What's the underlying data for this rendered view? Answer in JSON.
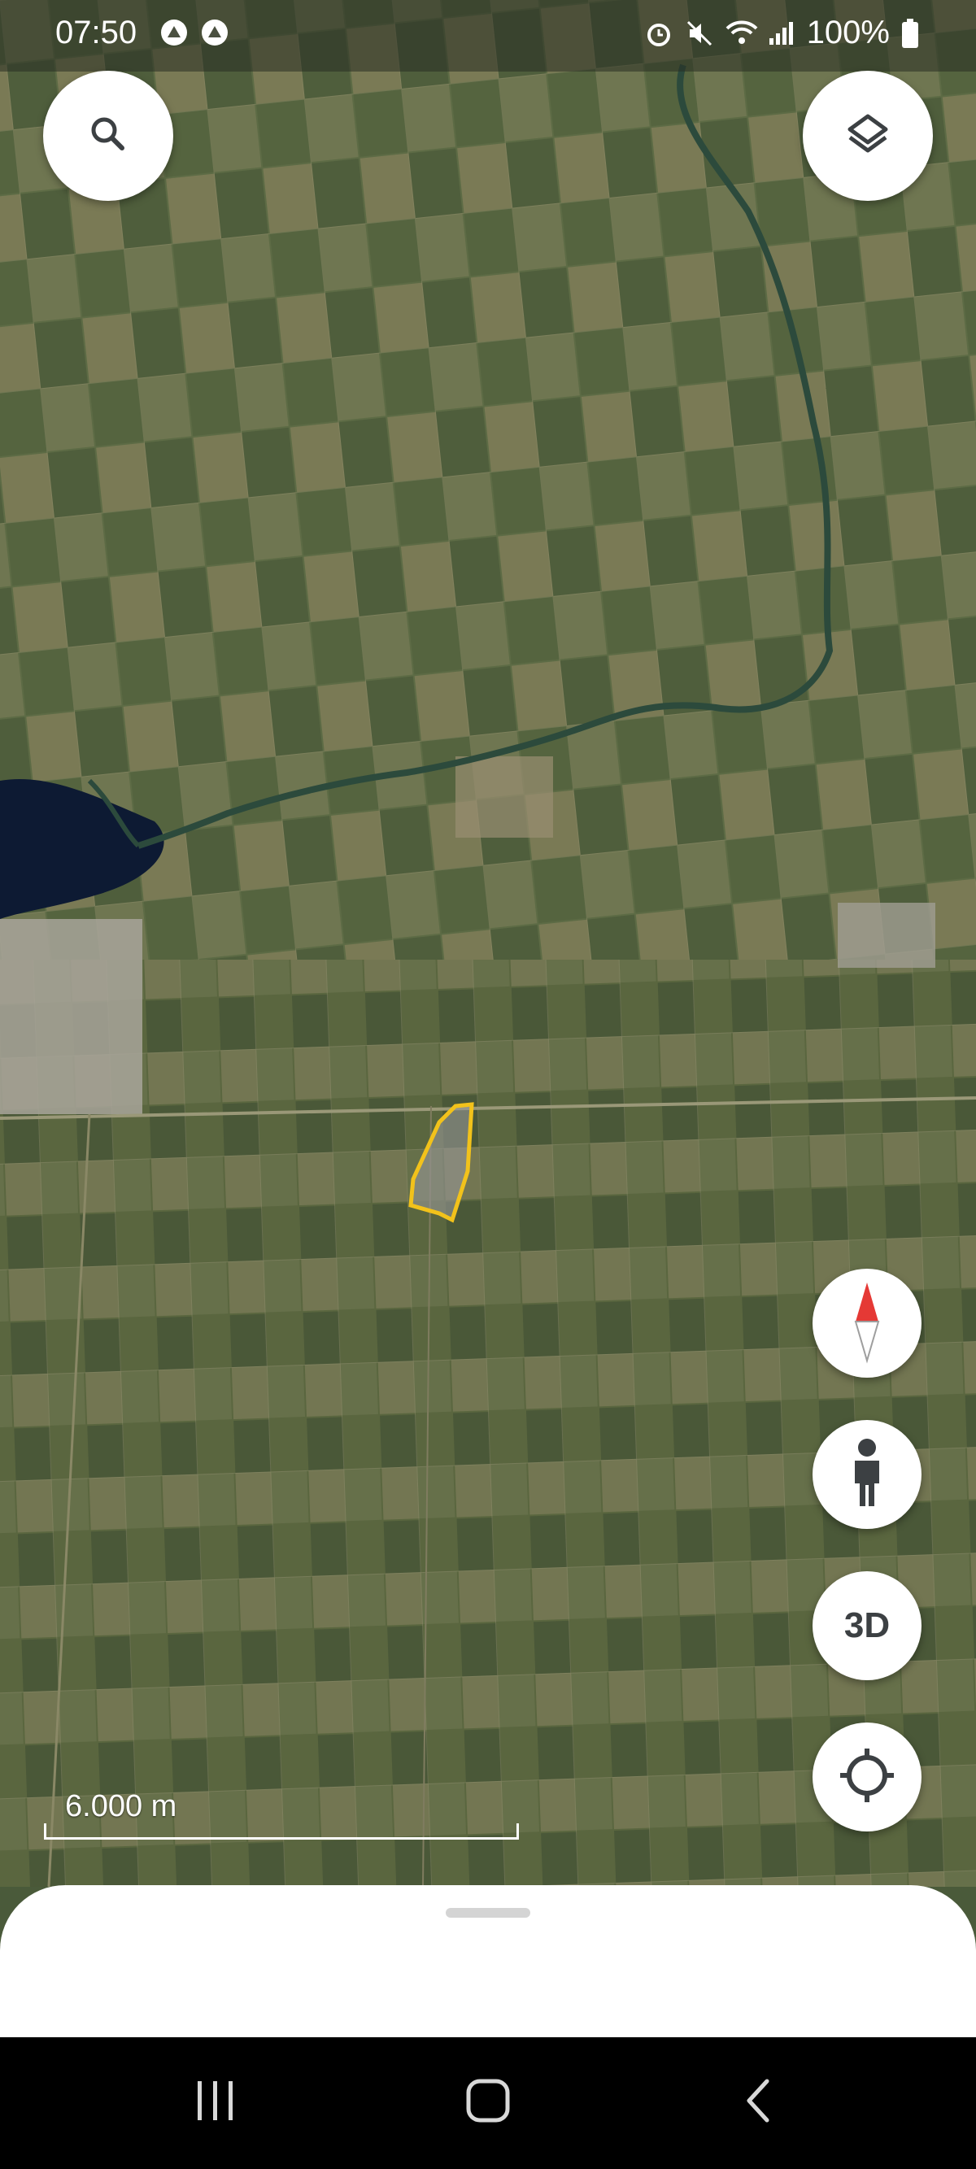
{
  "status_bar": {
    "time": "07:50",
    "left_icons": [
      "notification-a-icon",
      "notification-b-icon"
    ],
    "right_icons": [
      "alarm-icon",
      "mute-icon",
      "wifi-icon",
      "signal-icon"
    ],
    "battery": "100%"
  },
  "map": {
    "type": "satellite",
    "scale_label": "6.000 m",
    "highlight_outline_color": "#f2c21b"
  },
  "buttons": {
    "search": "search-icon",
    "layers": "layers-icon",
    "compass": "compass-icon",
    "street_view": "pegman-icon",
    "three_d_label": "3D",
    "my_location": "my-location-icon"
  },
  "nav_bar": [
    "recents-icon",
    "home-icon",
    "back-icon"
  ]
}
